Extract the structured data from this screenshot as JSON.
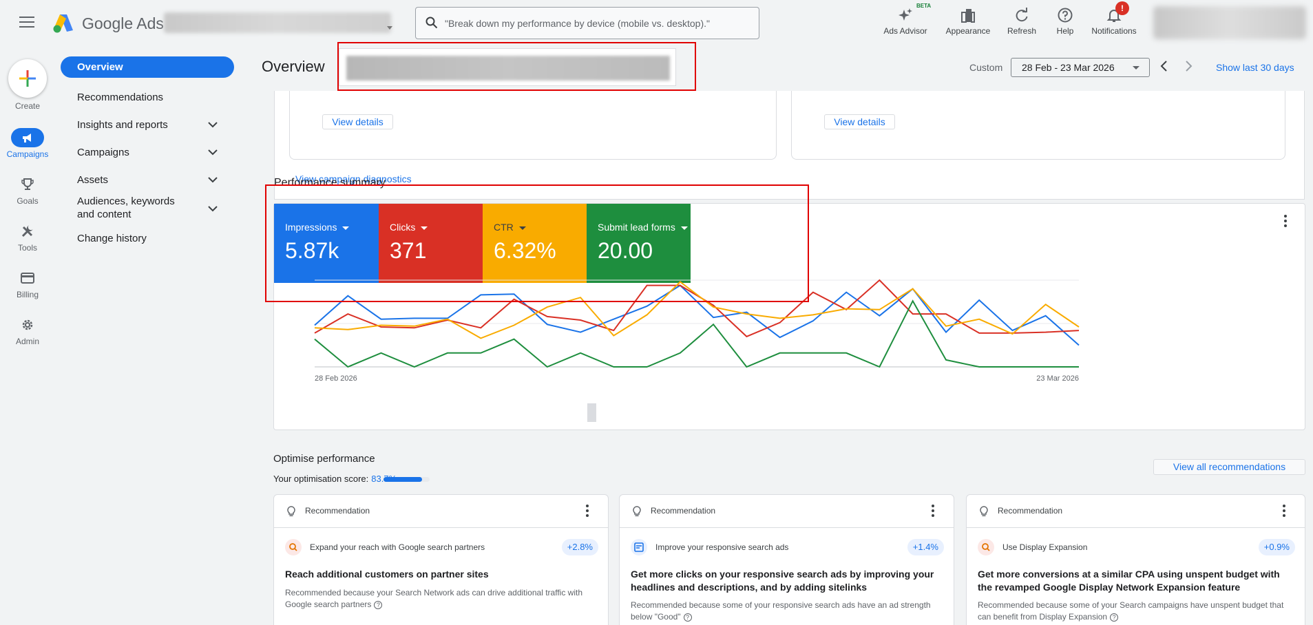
{
  "header": {
    "brand": "Google Ads",
    "search_placeholder": "\"Break down my performance by device (mobile vs. desktop).\"",
    "tools": [
      {
        "label": "Ads Advisor",
        "badge": "BETA"
      },
      {
        "label": "Appearance"
      },
      {
        "label": "Refresh"
      },
      {
        "label": "Help"
      },
      {
        "label": "Notifications",
        "badge": "!"
      }
    ]
  },
  "rail": {
    "create_label": "Create",
    "items": [
      {
        "label": "Campaigns",
        "icon": "megaphone-icon",
        "active": true
      },
      {
        "label": "Goals",
        "icon": "trophy-icon"
      },
      {
        "label": "Tools",
        "icon": "tools-icon"
      },
      {
        "label": "Billing",
        "icon": "card-icon"
      },
      {
        "label": "Admin",
        "icon": "gear-icon"
      }
    ]
  },
  "nav": {
    "items": [
      {
        "label": "Overview",
        "active": true
      },
      {
        "label": "Recommendations"
      },
      {
        "label": "Insights and reports",
        "expandable": true
      },
      {
        "label": "Campaigns",
        "expandable": true
      },
      {
        "label": "Assets",
        "expandable": true
      },
      {
        "label": "Audiences, keywords and content",
        "expandable": true
      },
      {
        "label": "Change history"
      }
    ]
  },
  "main": {
    "title": "Overview",
    "date_label": "Custom",
    "date_range": "28 Feb - 23 Mar 2026",
    "show_last": "Show last 30 days",
    "view_details": "View details",
    "view_diagnostics": "View campaign diagnostics"
  },
  "performance": {
    "title": "Performance summary",
    "metrics": [
      {
        "label": "Impressions",
        "value": "5.87k",
        "color": "#1a73e8"
      },
      {
        "label": "Clicks",
        "value": "371",
        "color": "#d93025"
      },
      {
        "label": "CTR",
        "value": "6.32%",
        "color": "#f9ab00"
      },
      {
        "label": "Submit lead forms",
        "value": "20.00",
        "color": "#1e8e3e"
      }
    ]
  },
  "chart_data": {
    "type": "line",
    "x_start": "28 Feb 2026",
    "x_end": "23 Mar 2026",
    "x_labels": [
      "28 Feb 2026",
      "23 Mar 2026"
    ],
    "y_normalized": true,
    "ylim": [
      0,
      1
    ],
    "series": [
      {
        "name": "Impressions",
        "color": "#1a73e8",
        "values": [
          0.48,
          0.82,
          0.55,
          0.56,
          0.56,
          0.83,
          0.84,
          0.49,
          0.4,
          0.55,
          0.7,
          0.94,
          0.57,
          0.63,
          0.34,
          0.53,
          0.86,
          0.59,
          0.9,
          0.4,
          0.77,
          0.42,
          0.59,
          0.25
        ]
      },
      {
        "name": "Clicks",
        "color": "#d93025",
        "values": [
          0.39,
          0.61,
          0.46,
          0.45,
          0.54,
          0.45,
          0.78,
          0.58,
          0.54,
          0.42,
          0.94,
          0.94,
          0.71,
          0.35,
          0.51,
          0.86,
          0.66,
          1.0,
          0.61,
          0.61,
          0.39,
          0.39,
          0.4,
          0.42
        ]
      },
      {
        "name": "CTR",
        "color": "#f9ab00",
        "values": [
          0.45,
          0.43,
          0.48,
          0.47,
          0.55,
          0.33,
          0.48,
          0.69,
          0.8,
          0.36,
          0.6,
          0.98,
          0.69,
          0.61,
          0.56,
          0.6,
          0.67,
          0.66,
          0.9,
          0.47,
          0.55,
          0.38,
          0.72,
          0.46
        ]
      },
      {
        "name": "Submit lead forms",
        "color": "#1e8e3e",
        "values": [
          0.32,
          0.0,
          0.16,
          0.0,
          0.16,
          0.16,
          0.32,
          0.0,
          0.16,
          0.0,
          0.0,
          0.16,
          0.49,
          0.0,
          0.16,
          0.16,
          0.16,
          0.0,
          0.76,
          0.08,
          0.0,
          0.0,
          0.0,
          0.0
        ]
      }
    ]
  },
  "optimise": {
    "title": "Optimise performance",
    "score_label": "Your optimisation score:",
    "score": "83.7%",
    "score_fraction": 0.837,
    "view_all": "View all recommendations",
    "cards": [
      {
        "header": "Recommendation",
        "icon": "search-icon",
        "subtitle": "Expand your reach with Google search partners",
        "uplift": "+2.8%",
        "title": "Reach additional customers on partner sites",
        "reason": "Recommended because your Search Network ads can drive additional traffic with Google search partners"
      },
      {
        "header": "Recommendation",
        "icon": "ad-icon",
        "subtitle": "Improve your responsive search ads",
        "uplift": "+1.4%",
        "title": "Get more clicks on your responsive search ads by improving your headlines and descriptions, and by adding sitelinks",
        "reason": "Recommended because some of your responsive search ads have an ad strength below \"Good\""
      },
      {
        "header": "Recommendation",
        "icon": "search-icon",
        "subtitle": "Use Display Expansion",
        "uplift": "+0.9%",
        "title": "Get more conversions at a similar CPA using unspent budget with the revamped Google Display Network Expansion feature",
        "reason": "Recommended because some of your Search campaigns have unspent budget that can benefit from Display Expansion"
      }
    ]
  }
}
